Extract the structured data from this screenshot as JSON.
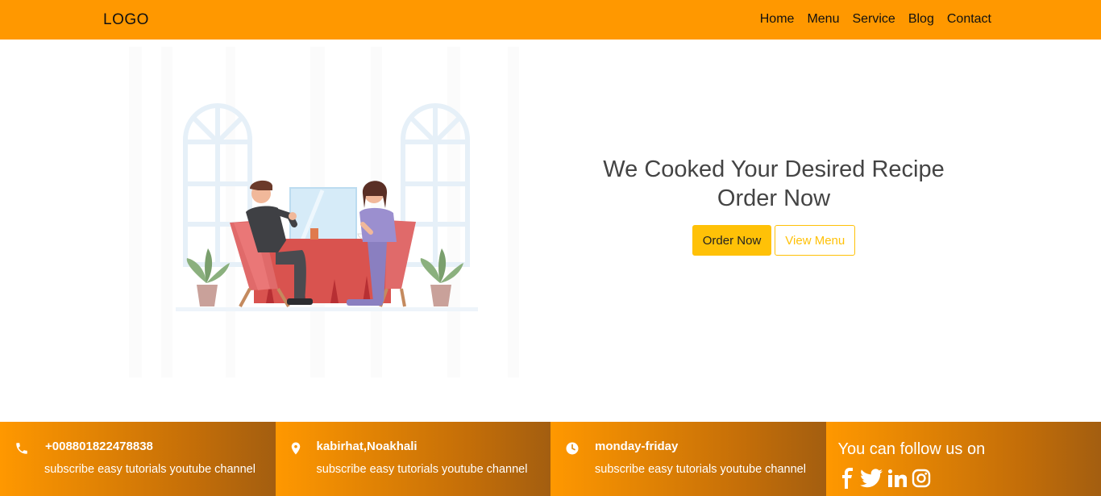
{
  "nav": {
    "logo": "LOGO",
    "links": [
      "Home",
      "Menu",
      "Service",
      "Blog",
      "Contact"
    ]
  },
  "hero": {
    "headline_line1": "We Cooked Your Desired Recipe",
    "headline_line2": "Order Now",
    "order_button": "Order Now",
    "menu_button": "View Menu"
  },
  "footer": {
    "phone": {
      "title": "+008801822478838",
      "subtitle": "subscribe easy tutorials youtube channel",
      "icon": "phone-icon"
    },
    "location": {
      "title": "kabirhat,Noakhali",
      "subtitle": "subscribe easy tutorials youtube channel",
      "icon": "map-marker-icon"
    },
    "hours": {
      "title": "monday-friday",
      "subtitle": "subscribe easy tutorials youtube channel",
      "icon": "clock-icon"
    },
    "follow": {
      "title": "You can follow us on",
      "icons": [
        "facebook-icon",
        "twitter-icon",
        "linkedin-icon",
        "instagram-icon"
      ]
    }
  },
  "colors": {
    "nav_bg": "#ff9800",
    "accent": "#ffc107",
    "footer_dark": "#a35e10"
  }
}
